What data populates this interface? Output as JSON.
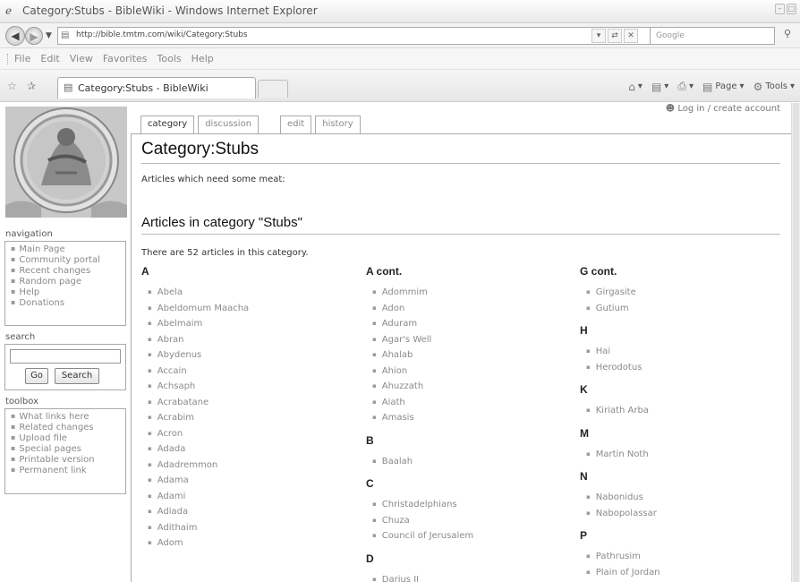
{
  "window": {
    "title": "Category:Stubs - BibleWiki - Windows Internet Explorer",
    "address": "http://bible.tmtm.com/wiki/Category:Stubs",
    "search_placeholder": "Google"
  },
  "menu": [
    "File",
    "Edit",
    "View",
    "Favorites",
    "Tools",
    "Help"
  ],
  "tab": {
    "label": "Category:Stubs - BibleWiki"
  },
  "commands": {
    "page": "Page",
    "tools": "Tools"
  },
  "wiki": {
    "user_links": "Log in / create account",
    "tabs": [
      "category",
      "discussion",
      "edit",
      "history"
    ],
    "navigation": {
      "title": "navigation",
      "items": [
        "Main Page",
        "Community portal",
        "Recent changes",
        "Random page",
        "Help",
        "Donations"
      ]
    },
    "search": {
      "title": "search",
      "go": "Go",
      "search": "Search"
    },
    "toolbox": {
      "title": "toolbox",
      "items": [
        "What links here",
        "Related changes",
        "Upload file",
        "Special pages",
        "Printable version",
        "Permanent link"
      ]
    },
    "page_title": "Category:Stubs",
    "intro": "Articles which need some meat:",
    "subheading": "Articles in category \"Stubs\"",
    "count_text": "There are 52 articles in this category.",
    "columns": [
      [
        {
          "letter": "A",
          "items": [
            "Abela",
            "Abeldomum Maacha",
            "Abelmaim",
            "Abran",
            "Abydenus",
            "Accain",
            "Achsaph",
            "Acrabatane",
            "Acrabim",
            "Acron",
            "Adada",
            "Adadremmon",
            "Adama",
            "Adami",
            "Adiada",
            "Adithaim",
            "Adom"
          ]
        }
      ],
      [
        {
          "letter": "A cont.",
          "items": [
            "Adommim",
            "Adon",
            "Aduram",
            "Agar's Well",
            "Ahalab",
            "Ahion",
            "Ahuzzath",
            "Aiath",
            "Amasis"
          ]
        },
        {
          "letter": "B",
          "items": [
            "Baalah"
          ]
        },
        {
          "letter": "C",
          "items": [
            "Christadelphians",
            "Chuza",
            "Council of Jerusalem"
          ]
        },
        {
          "letter": "D",
          "items": [
            "Darius II"
          ]
        }
      ],
      [
        {
          "letter": "G cont.",
          "items": [
            "Girgasite",
            "Gutium"
          ]
        },
        {
          "letter": "H",
          "items": [
            "Hai",
            "Herodotus"
          ]
        },
        {
          "letter": "K",
          "items": [
            "Kiriath Arba"
          ]
        },
        {
          "letter": "M",
          "items": [
            "Martin Noth"
          ]
        },
        {
          "letter": "N",
          "items": [
            "Nabonidus",
            "Nabopolassar"
          ]
        },
        {
          "letter": "P",
          "items": [
            "Pathrusim",
            "Plain of Jordan"
          ]
        }
      ]
    ]
  }
}
